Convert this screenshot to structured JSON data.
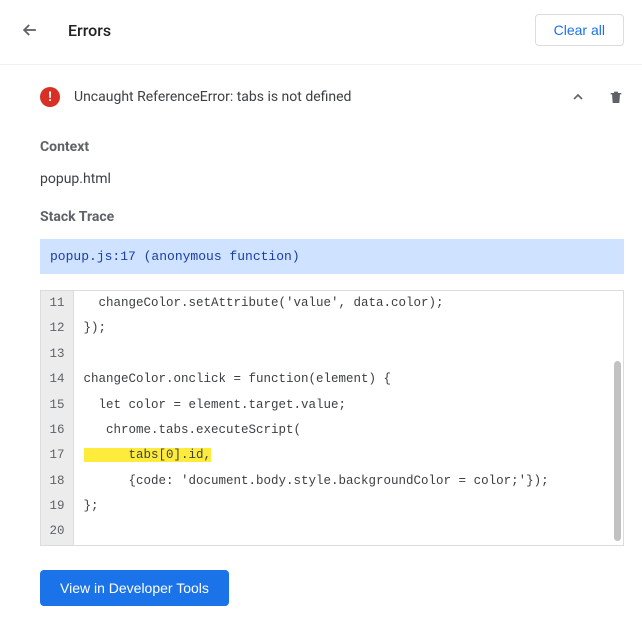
{
  "header": {
    "title": "Errors",
    "clear_btn": "Clear all"
  },
  "error": {
    "badge": "!",
    "message": "Uncaught ReferenceError: tabs is not defined"
  },
  "context_label": "Context",
  "context_value": "popup.html",
  "stack_label": "Stack Trace",
  "stack_link": "popup.js:17 (anonymous function)",
  "code": {
    "lines": [
      {
        "n": "11",
        "text": "  changeColor.setAttribute('value', data.color);",
        "hl": false
      },
      {
        "n": "12",
        "text": "});",
        "hl": false
      },
      {
        "n": "13",
        "text": "",
        "hl": false
      },
      {
        "n": "14",
        "text": "changeColor.onclick = function(element) {",
        "hl": false
      },
      {
        "n": "15",
        "text": "  let color = element.target.value;",
        "hl": false
      },
      {
        "n": "16",
        "text": "   chrome.tabs.executeScript(",
        "hl": false
      },
      {
        "n": "17",
        "text": "      tabs[0].id,",
        "hl": true
      },
      {
        "n": "18",
        "text": "      {code: 'document.body.style.backgroundColor = color;'});",
        "hl": false
      },
      {
        "n": "19",
        "text": "};",
        "hl": false
      },
      {
        "n": "20",
        "text": "",
        "hl": false
      }
    ]
  },
  "view_btn": "View in Developer Tools"
}
